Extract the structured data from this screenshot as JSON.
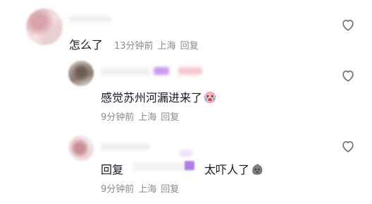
{
  "comments": [
    {
      "text": "怎么了",
      "time": "13分钟前",
      "location": "上海",
      "reply_label": "回复"
    },
    {
      "text": "感觉苏州河漏进来了",
      "emoji": "crying-face-emoji",
      "time": "9分钟前",
      "location": "上海",
      "reply_label": "回复"
    },
    {
      "prefix": "回复",
      "text_after_mention": "太吓人了",
      "emoji": "stone-face-emoji",
      "time": "9分钟前",
      "location": "上海",
      "reply_label": "回复"
    }
  ],
  "icons": {
    "like": "heart-outline-icon"
  },
  "colors": {
    "text": "#161823",
    "meta": "#8a8b91",
    "tag_purple": "#b07ce8"
  }
}
